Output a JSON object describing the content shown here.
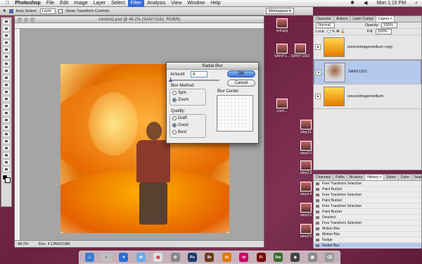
{
  "menubar": {
    "app_name": "Photoshop",
    "menus": [
      "File",
      "Edit",
      "Image",
      "Layer",
      "Select",
      "Filter",
      "Analysis",
      "View",
      "Window",
      "Help"
    ],
    "active_menu": "Filter",
    "clock": "Mon 1:15 PM"
  },
  "options_bar": {
    "auto_select_label": "Auto-Select:",
    "auto_select_value": "Layer",
    "show_transform_label": "Show Transform Controls",
    "workspace_label": "Workspace ▾"
  },
  "document": {
    "title": "contest2.psd @ 48.2% (SANY1162, RGB/8)",
    "zoom": "48.2%",
    "doc_size": "Doc: 4.12M/10.8M"
  },
  "desktop_files": [
    "red.jpg",
    "SANY1...",
    "SANY1162",
    "cont...",
    "step11",
    "step12",
    "step13",
    "step14",
    "step15",
    "step16",
    "step17",
    "step18",
    "step19",
    "step20"
  ],
  "dialog": {
    "title": "Radial Blur",
    "amount_label": "Amount",
    "amount_value": "4",
    "ok_label": "OK",
    "cancel_label": "Cancel",
    "blur_method_label": "Blur Method:",
    "method_spin": "Spin",
    "method_zoom": "Zoom",
    "quality_label": "Quality:",
    "quality_draft": "Draft",
    "quality_good": "Good",
    "quality_best": "Best",
    "blur_center_label": "Blur Center"
  },
  "layers_panel": {
    "tabs": [
      "Character",
      "Actions",
      "Layer Comps",
      "Layers ×"
    ],
    "blend_mode": "Normal",
    "opacity_label": "Opacity:",
    "opacity_value": "100%",
    "lock_label": "Lock:",
    "fill_label": "Fill:",
    "fill_value": "100%",
    "layers": [
      {
        "name": "sourceimagemedium copy",
        "selected": false
      },
      {
        "name": "SANY1162",
        "selected": true
      },
      {
        "name": "sourceimagemedium",
        "selected": false
      }
    ]
  },
  "history_panel": {
    "tabs": [
      "Channels",
      "Paths",
      "Brushes",
      "History ×",
      "Styles",
      "Color",
      "Swatches"
    ],
    "items": [
      "Free Transform Selection",
      "Paint Bucket",
      "Free Transform Selection",
      "Paint Bucket",
      "Free Transform Selection",
      "Paint Bucket",
      "Deselect",
      "Free Transform Selection",
      "Motion Blur",
      "Motion Blur",
      "Nudge",
      "Radial Blur"
    ]
  },
  "colors": {
    "accent": "#3869d4",
    "desktop": "#7a2a48"
  }
}
